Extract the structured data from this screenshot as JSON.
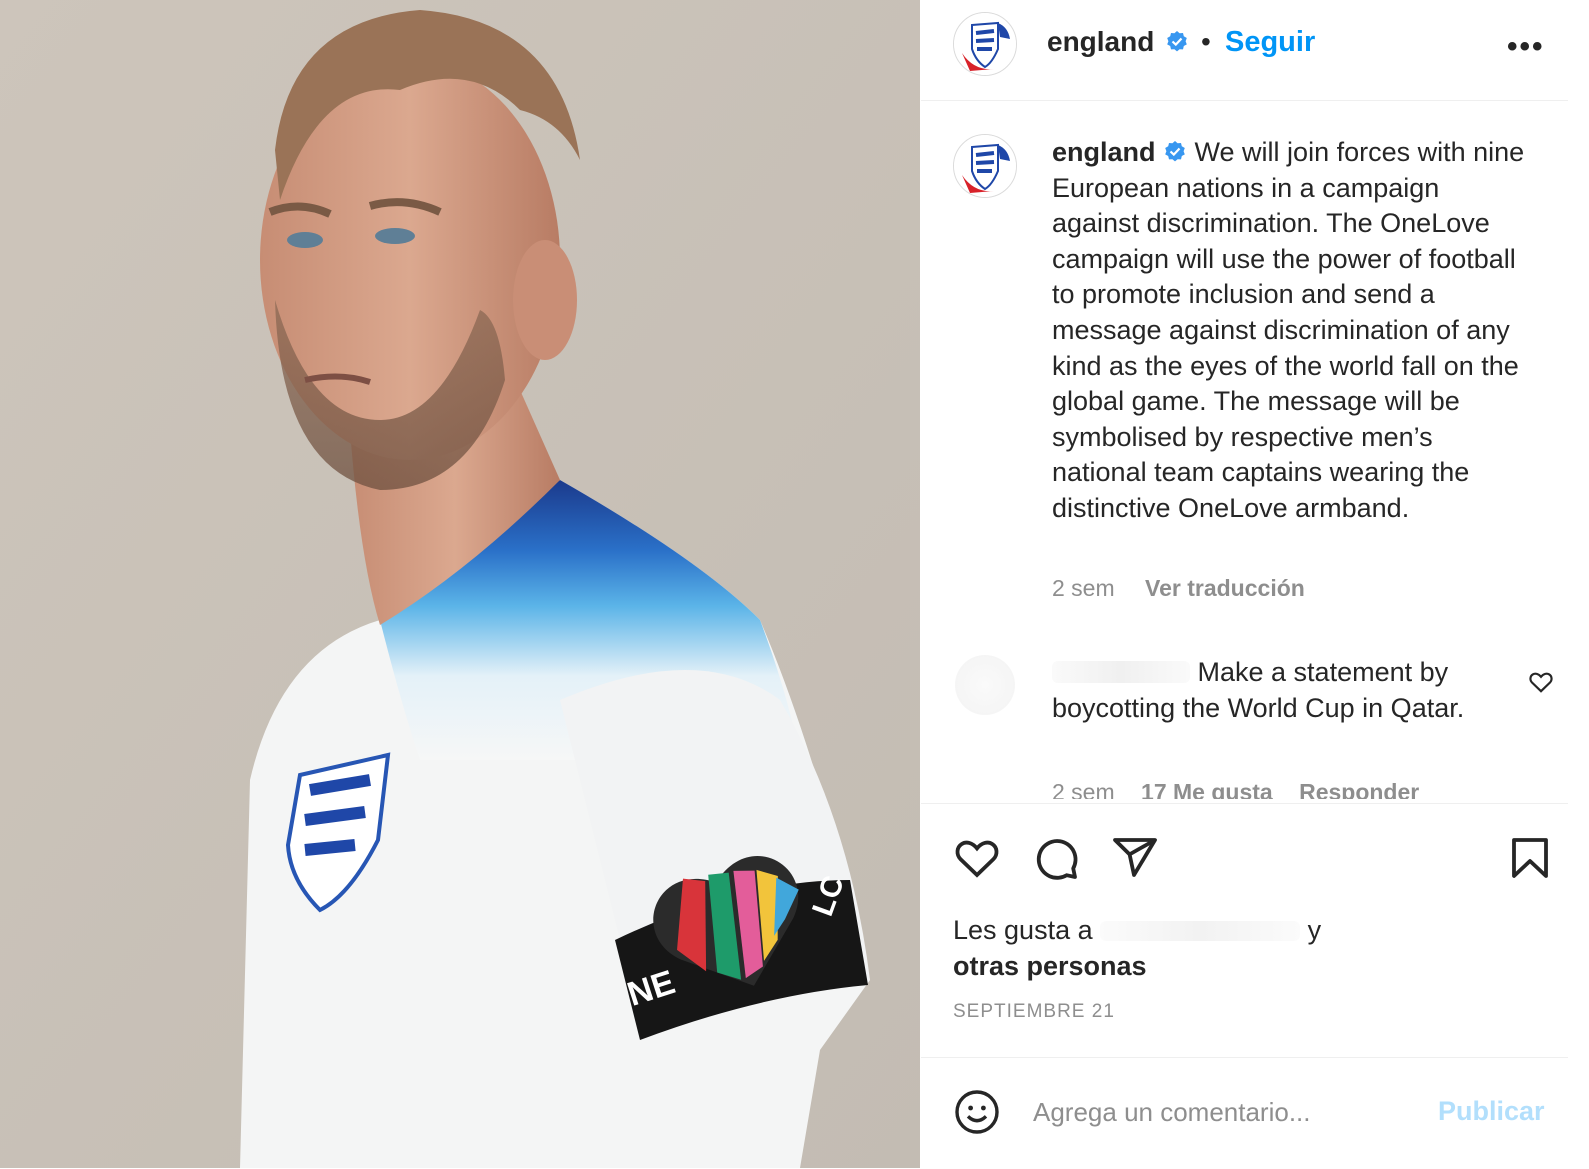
{
  "post": {
    "username": "england",
    "follow_label": "Seguir",
    "dot": "•",
    "more_label": "•••",
    "caption": "We will join forces with nine European nations in a campaign against discrimination. The OneLove campaign will use the power of football to promote inclusion and send a message against discrimination of any kind as the eyes of the world fall on the global game. The message will be symbolised by respective men’s national team captains wearing the distinctive OneLove armband.",
    "time": "2 sem",
    "translate_label": "Ver traducción",
    "likes_prefix": "Les gusta a",
    "likes_connector": "y",
    "likes_rest": "otras personas",
    "date": "SEPTIEMBRE 21"
  },
  "photo": {
    "armband_text_left": "NE",
    "armband_text_right": "LC"
  },
  "comment": {
    "text": "Make a statement by boycotting the World Cup in Qatar.",
    "time": "2 sem",
    "likes": "17 Me gusta",
    "reply_label": "Responder"
  },
  "add_comment": {
    "placeholder": "Agrega un comentario...",
    "publish_label": "Publicar"
  },
  "colors": {
    "link": "#0095f6",
    "publish_disabled": "#b2dffc",
    "secondary_text": "#8e8e8e",
    "verified": "#3897f0"
  }
}
